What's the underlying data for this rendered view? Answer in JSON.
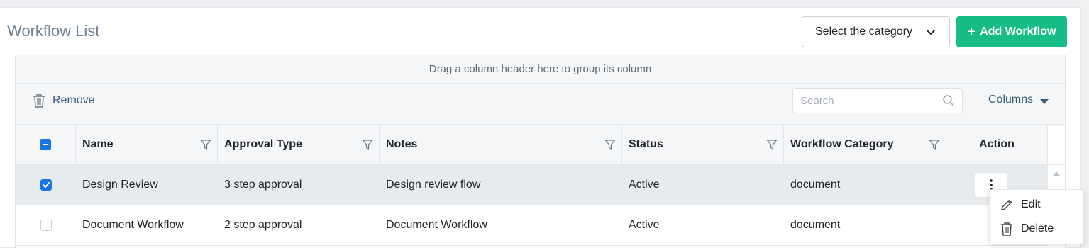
{
  "header": {
    "title": "Workflow List",
    "category_select": {
      "value": "Select the category"
    },
    "add_button": {
      "label": "Add Workflow"
    }
  },
  "grid": {
    "group_panel_text": "Drag a column header here to group its column",
    "toolbar": {
      "remove_label": "Remove",
      "search_placeholder": "Search",
      "columns_label": "Columns"
    },
    "columns": [
      "Name",
      "Approval Type",
      "Notes",
      "Status",
      "Workflow Category",
      "Action"
    ],
    "rows": [
      {
        "checked": true,
        "name": "Design Review",
        "approval_type": "3 step approval",
        "notes": "Design review flow",
        "status": "Active",
        "category": "document"
      },
      {
        "checked": false,
        "name": "Document Workflow",
        "approval_type": "2 step approval",
        "notes": "Document Workflow",
        "status": "Active",
        "category": "document"
      }
    ]
  },
  "action_menu": {
    "edit_label": "Edit",
    "delete_label": "Delete"
  },
  "colors": {
    "accent": "#17bd85",
    "checkbox": "#1a73e8",
    "link": "#3b5b7c"
  },
  "icons": [
    "chevron-down-icon",
    "plus-icon",
    "trash-icon",
    "search-icon",
    "caret-down-icon",
    "filter-icon",
    "kebab-icon",
    "pencil-icon"
  ]
}
